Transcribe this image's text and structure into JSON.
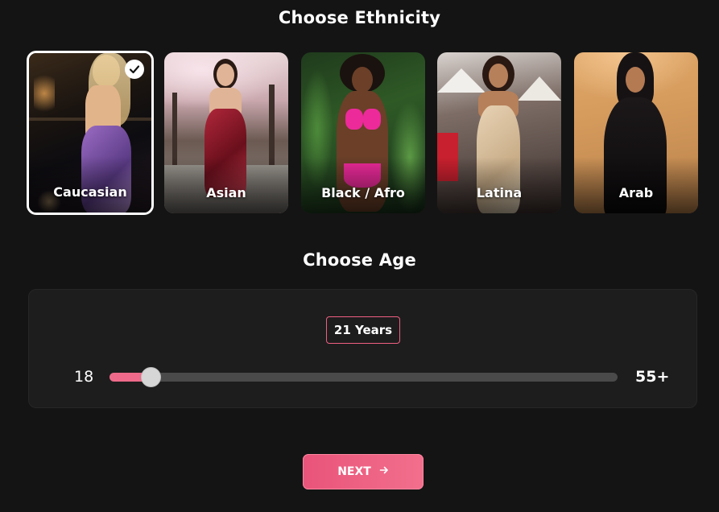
{
  "ethnicity": {
    "title": "Choose Ethnicity",
    "options": [
      {
        "label": "Caucasian",
        "selected": true
      },
      {
        "label": "Asian",
        "selected": false
      },
      {
        "label": "Black / Afro",
        "selected": false
      },
      {
        "label": "Latina",
        "selected": false
      },
      {
        "label": "Arab",
        "selected": false
      }
    ]
  },
  "age": {
    "title": "Choose Age",
    "value_label": "21 Years",
    "min_label": "18",
    "max_label": "55+",
    "min": 18,
    "max": 55,
    "value": 21
  },
  "next_button": {
    "label": "NEXT",
    "icon": "arrow-right-icon"
  },
  "colors": {
    "accent": "#ef6a8a",
    "background": "#141414"
  }
}
